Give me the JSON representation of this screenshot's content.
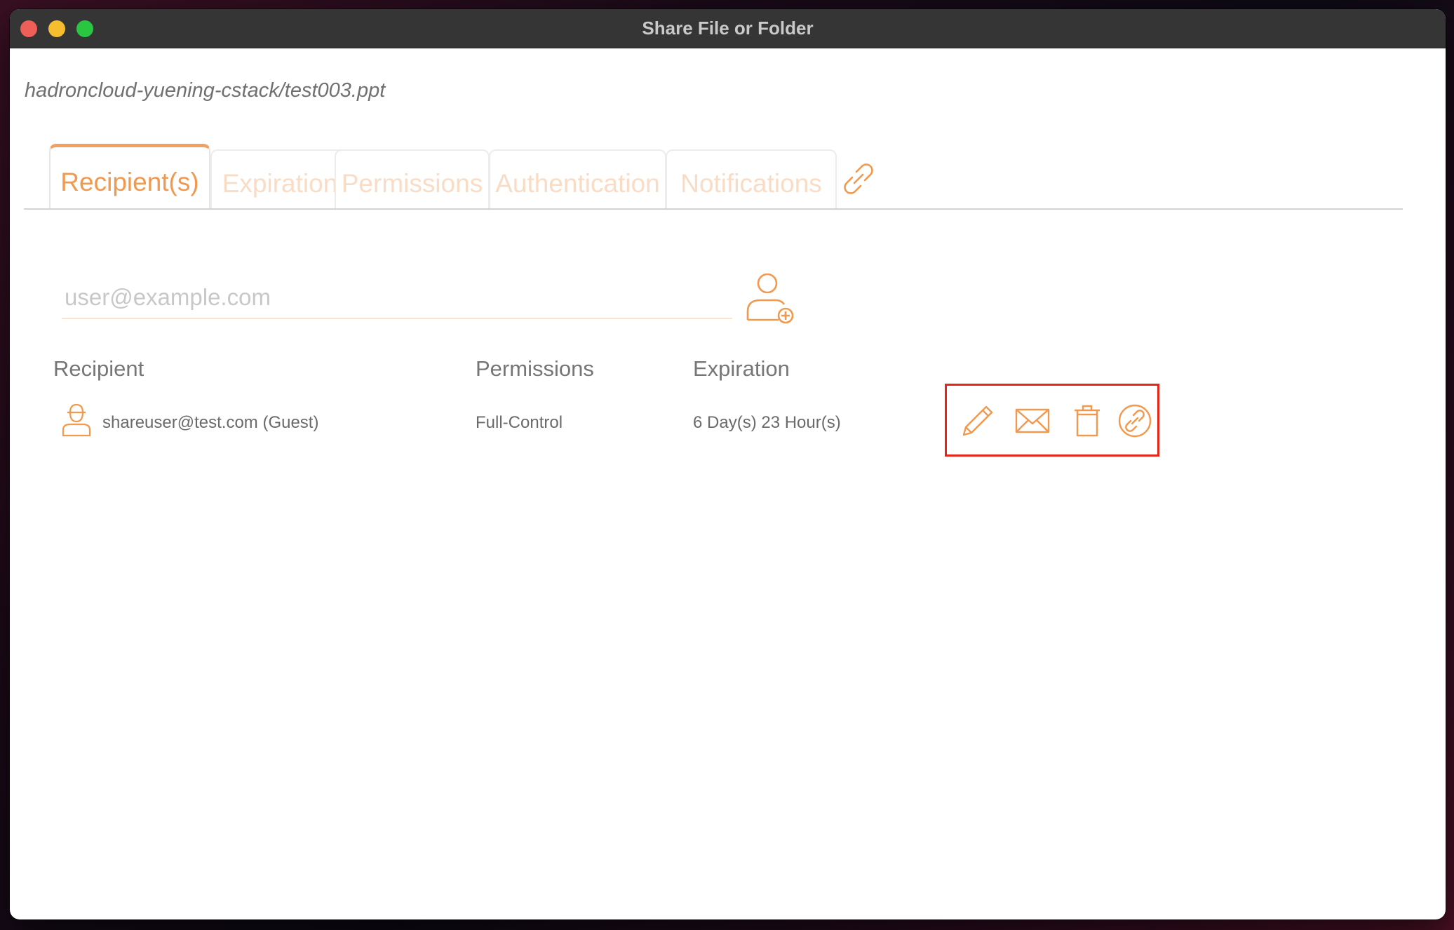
{
  "window": {
    "title": "Share File or Folder",
    "file_path": "hadroncloud-yuening-cstack/test003.ppt"
  },
  "tabs": [
    {
      "label": "Recipient(s)",
      "active": true
    },
    {
      "label": "Expiration",
      "active": false
    },
    {
      "label": "Permissions",
      "active": false
    },
    {
      "label": "Authentication",
      "active": false
    },
    {
      "label": "Notifications",
      "active": false
    }
  ],
  "tab_icons": [
    "link-icon"
  ],
  "recipient_input": {
    "placeholder": "user@example.com",
    "value": ""
  },
  "add_button_icon": "add-user-icon",
  "table": {
    "headers": {
      "recipient": "Recipient",
      "permissions": "Permissions",
      "expiration": "Expiration"
    },
    "rows": [
      {
        "icon": "guest-user-icon",
        "recipient": "shareuser@test.com (Guest)",
        "permissions": "Full-Control",
        "expiration": "6 Day(s) 23 Hour(s)",
        "actions": [
          "edit-icon",
          "email-icon",
          "delete-icon",
          "link-icon"
        ]
      }
    ]
  },
  "colors": {
    "accent": "#f0994f",
    "highlight_box": "#e2261c",
    "titlebar": "#353535"
  }
}
